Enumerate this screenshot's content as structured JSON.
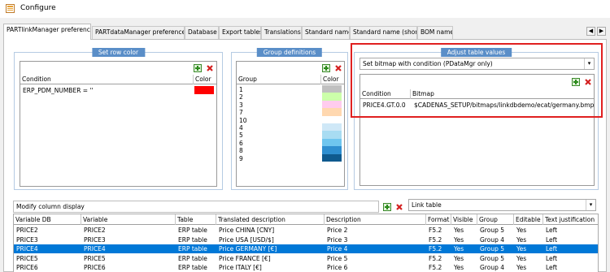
{
  "window": {
    "title": "Configure"
  },
  "tabs": [
    "PARTlinkManager preferences",
    "PARTdataManager preferences",
    "Database",
    "Export tables",
    "Translations",
    "Standard name",
    "Standard name (short)",
    "BOM name"
  ],
  "tab_nav": {
    "prev": "◀",
    "next": "▶"
  },
  "set_row_color": {
    "title": "Set row color",
    "columns": [
      "Condition",
      "Color"
    ],
    "rows": [
      {
        "condition": "ERP_PDM_NUMBER = ''",
        "color": "#ff0000"
      }
    ]
  },
  "group_definitions": {
    "title": "Group definitions",
    "columns": [
      "Group",
      "Color"
    ],
    "rows": [
      {
        "group": "1",
        "color": "#c0c0c0"
      },
      {
        "group": "2",
        "color": "#ccffaa"
      },
      {
        "group": "3",
        "color": "#ffccee"
      },
      {
        "group": "7",
        "color": "#ffd8b0"
      },
      {
        "group": "10",
        "color": "#ffffff"
      },
      {
        "group": "4",
        "color": "#cfe8f7"
      },
      {
        "group": "5",
        "color": "#a8dcf2"
      },
      {
        "group": "6",
        "color": "#6fc6ef"
      },
      {
        "group": "8",
        "color": "#2f8fd0"
      },
      {
        "group": "9",
        "color": "#0f5a8e"
      }
    ]
  },
  "adjust_table_values": {
    "title": "Adjust table values",
    "dropdown_value": "Set bitmap with condition (PDataMgr only)",
    "columns": [
      "Condition",
      "Bitmap"
    ],
    "rows": [
      {
        "condition": "PRICE4.GT.0.0",
        "bitmap": "$CADENAS_SETUP/bitmaps/linkdbdemo/ecat/germany.bmp"
      }
    ]
  },
  "modify_column_display": {
    "dropdown_value": "Modify column display",
    "link_dropdown_value": "Link table",
    "columns": [
      "Variable DB",
      "Variable",
      "Table",
      "Translated description",
      "Description",
      "Format",
      "Visible",
      "Group",
      "Editable",
      "Text justification"
    ],
    "rows": [
      [
        "PRICE2",
        "PRICE2",
        "ERP table",
        "Price CHINA [CNY]",
        "Price 2",
        "F5.2",
        "Yes",
        "Group 5",
        "Yes",
        "Left"
      ],
      [
        "PRICE3",
        "PRICE3",
        "ERP table",
        "Price USA [USD/$]",
        "Price 3",
        "F5.2",
        "Yes",
        "Group 4",
        "Yes",
        "Left"
      ],
      [
        "PRICE4",
        "PRICE4",
        "ERP table",
        "Price GERMANY [€]",
        "Price 4",
        "F5.2",
        "Yes",
        "Group 5",
        "Yes",
        "Left"
      ],
      [
        "PRICE5",
        "PRICE5",
        "ERP table",
        "Price FRANCE [€]",
        "Price 5",
        "F5.2",
        "Yes",
        "Group 5",
        "Yes",
        "Left"
      ],
      [
        "PRICE6",
        "PRICE6",
        "ERP table",
        "Price ITALY [€]",
        "Price 6",
        "F5.2",
        "Yes",
        "Group 4",
        "Yes",
        "Left"
      ]
    ],
    "selected_row": 2
  },
  "colors": {
    "accent": "#0078d7",
    "group_title_bg": "#5a8ec8",
    "highlight": "#e02020"
  }
}
